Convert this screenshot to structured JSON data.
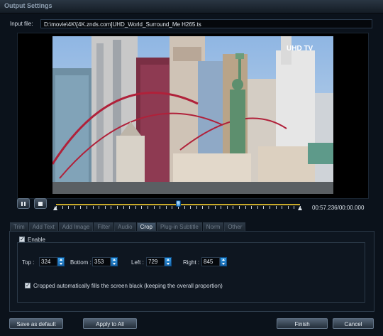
{
  "window": {
    "title": "Output Settings"
  },
  "input_file": {
    "label": "Input file:",
    "path": "D:\\movie\\4K\\[4K.znds.com]UHD_World_Surround_Me H265.ts"
  },
  "preview": {
    "watermark": "UHD TV"
  },
  "player": {
    "pause_icon": "pause-icon",
    "stop_icon": "stop-icon",
    "progress": 0.5,
    "time": "00:57.236/00:00.000"
  },
  "tabs": [
    {
      "label": "Trim",
      "active": false
    },
    {
      "label": "Add Text",
      "active": false
    },
    {
      "label": "Add Image",
      "active": false
    },
    {
      "label": "Filter",
      "active": false
    },
    {
      "label": "Audio",
      "active": false
    },
    {
      "label": "Crop",
      "active": true
    },
    {
      "label": "Plug-in Subtitle",
      "active": false
    },
    {
      "label": "Norm",
      "active": false
    },
    {
      "label": "Other",
      "active": false
    }
  ],
  "crop": {
    "enable_label": "Enable",
    "enabled": true,
    "top_label": "Top :",
    "top_value": "324",
    "bottom_label": "Bottom :",
    "bottom_value": "353",
    "left_label": "Left :",
    "left_value": "729",
    "right_label": "Right :",
    "right_value": "845",
    "auto_fill_label": "Cropped automatically fills the screen black (keeping the overall proportion)",
    "auto_fill_checked": true
  },
  "buttons": {
    "save_default": "Save as default",
    "apply_all": "Apply to All",
    "finish": "Finish",
    "cancel": "Cancel"
  },
  "colors": {
    "accent": "#1e7fd6",
    "timeline": "#c9aa2a"
  }
}
